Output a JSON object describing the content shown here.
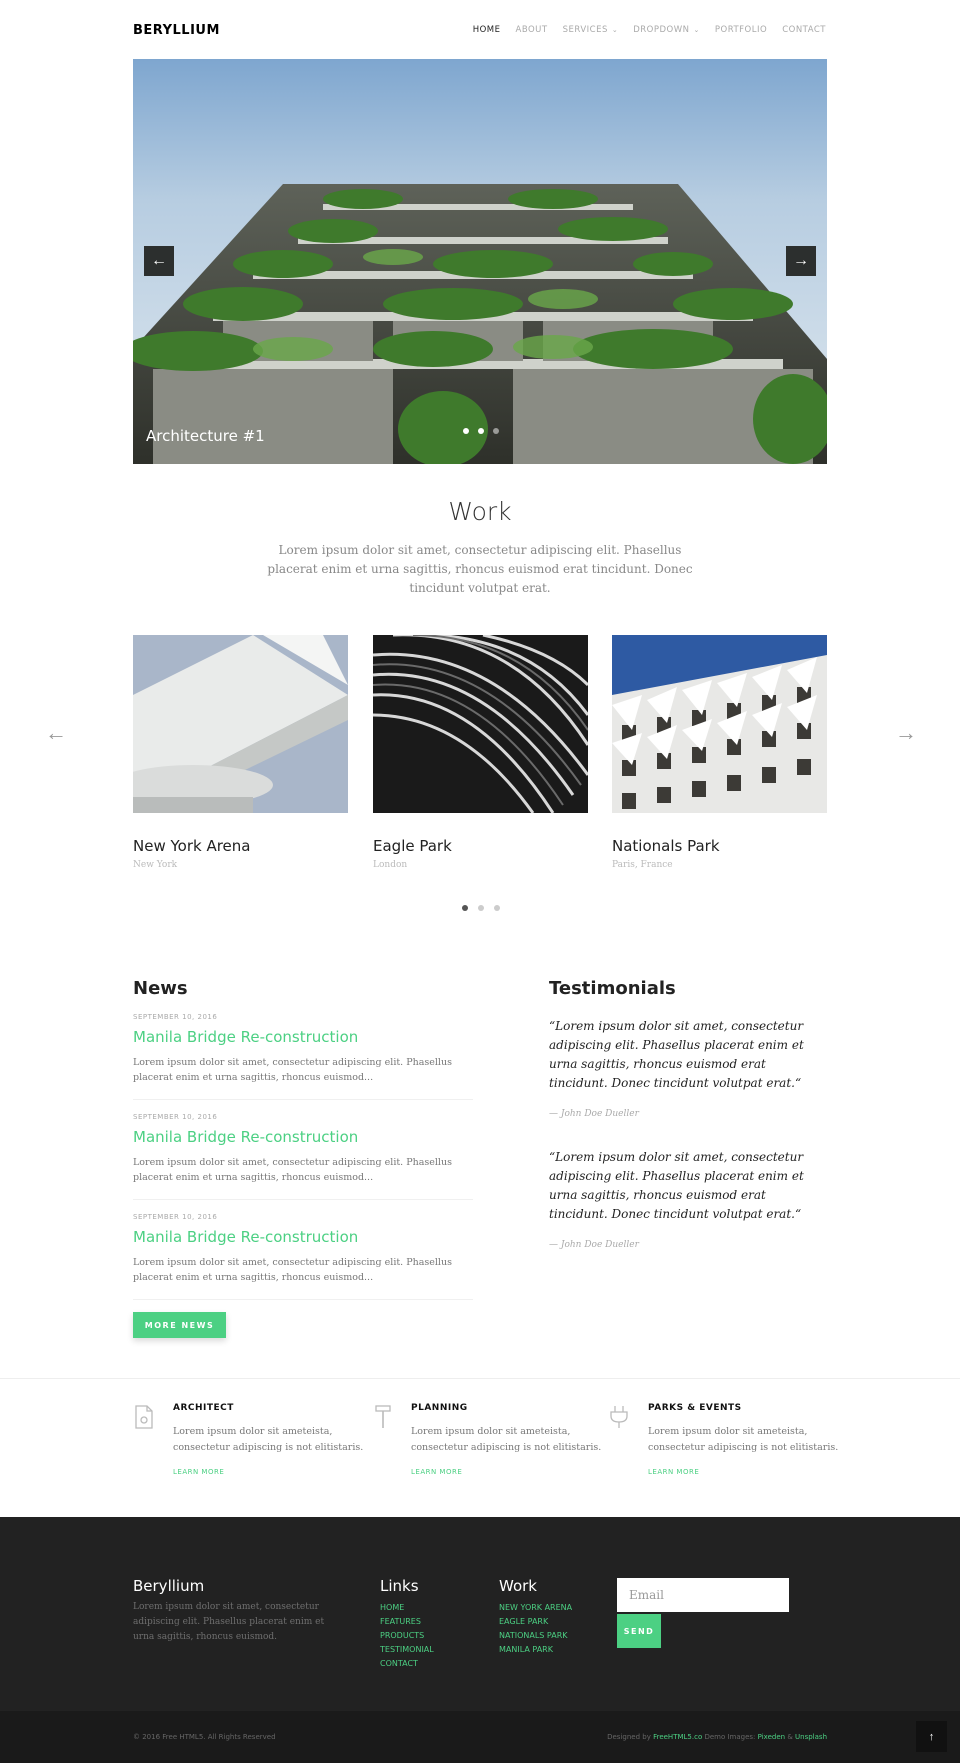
{
  "header": {
    "logo": "BERYLLIUM",
    "nav": [
      {
        "label": "HOME",
        "active": true
      },
      {
        "label": "ABOUT"
      },
      {
        "label": "SERVICES"
      },
      {
        "label": "DROPDOWN"
      },
      {
        "label": "PORTFOLIO"
      },
      {
        "label": "CONTACT"
      }
    ]
  },
  "hero": {
    "caption": "Architecture #1",
    "prev_icon": "arrow-left-icon",
    "next_icon": "arrow-right-icon",
    "slide_count": 3,
    "active_slide": 1
  },
  "work": {
    "title": "Work",
    "subtitle": "Lorem ipsum dolor sit amet, consectetur adipiscing elit. Phasellus placerat enim et urna sagittis, rhoncus euismod erat tincidunt. Donec tincidunt volutpat erat.",
    "items": [
      {
        "name": "New York Arena",
        "location": "New York"
      },
      {
        "name": "Eagle Park",
        "location": "London"
      },
      {
        "name": "Nationals Park",
        "location": "Paris, France"
      }
    ],
    "page_count": 3,
    "active_page": 1
  },
  "news": {
    "title": "News",
    "items": [
      {
        "date": "SEPTEMBER 10, 2016",
        "headline": "Manila Bridge Re-construction",
        "excerpt": "Lorem ipsum dolor sit amet, consectetur adipiscing elit. Phasellus placerat enim et urna sagittis, rhoncus euismod..."
      },
      {
        "date": "SEPTEMBER 10, 2016",
        "headline": "Manila Bridge Re-construction",
        "excerpt": "Lorem ipsum dolor sit amet, consectetur adipiscing elit. Phasellus placerat enim et urna sagittis, rhoncus euismod..."
      },
      {
        "date": "SEPTEMBER 10, 2016",
        "headline": "Manila Bridge Re-construction",
        "excerpt": "Lorem ipsum dolor sit amet, consectetur adipiscing elit. Phasellus placerat enim et urna sagittis, rhoncus euismod..."
      }
    ],
    "more_label": "MORE NEWS"
  },
  "testimonials": {
    "title": "Testimonials",
    "items": [
      {
        "quote": "“Lorem ipsum dolor sit amet, consectetur adipiscing elit. Phasellus placerat enim et urna sagittis, rhoncus euismod erat tincidunt. Donec tincidunt volutpat erat.“",
        "author": "— John Doe Dueller"
      },
      {
        "quote": "“Lorem ipsum dolor sit amet, consectetur adipiscing elit. Phasellus placerat enim et urna sagittis, rhoncus euismod erat tincidunt. Donec tincidunt volutpat erat.“",
        "author": "— John Doe Dueller"
      }
    ]
  },
  "features": [
    {
      "icon": "document-icon",
      "title": "ARCHITECT",
      "text": "Lorem ipsum dolor sit ameteista, consectetur adipiscing is not elitistaris.",
      "link": "LEARN MORE"
    },
    {
      "icon": "hammer-icon",
      "title": "PLANNING",
      "text": "Lorem ipsum dolor sit ameteista, consectetur adipiscing is not elitistaris.",
      "link": "LEARN MORE"
    },
    {
      "icon": "plug-icon",
      "title": "PARKS & EVENTS",
      "text": "Lorem ipsum dolor sit ameteista, consectetur adipiscing is not elitistaris.",
      "link": "LEARN MORE"
    }
  ],
  "footer": {
    "brand": "Beryllium",
    "about": "Lorem ipsum dolor sit amet, consectetur adipiscing elit. Phasellus placerat enim et urna sagittis, rhoncus euismod.",
    "links_title": "Links",
    "links": [
      "HOME",
      "FEATURES",
      "PRODUCTS",
      "TESTIMONIAL",
      "CONTACT"
    ],
    "work_title": "Work",
    "work_links": [
      "NEW YORK ARENA",
      "EAGLE PARK",
      "NATIONALS PARK",
      "MANILA PARK"
    ],
    "email_placeholder": "Email",
    "send_label": "SEND",
    "copyright": "© 2016 Free HTML5. All Rights Reserved",
    "credits": {
      "designed_by": "Designed by",
      "designer": "FreeHTML5.co",
      "demo_images": "Demo Images:",
      "source1": "Pixeden",
      "amp": "&",
      "source2": "Unsplash"
    },
    "top_icon": "arrow-up-icon"
  },
  "colors": {
    "accent": "#4cd083",
    "footer_bg": "#222222",
    "bottom_bg": "#1a1a1a"
  }
}
